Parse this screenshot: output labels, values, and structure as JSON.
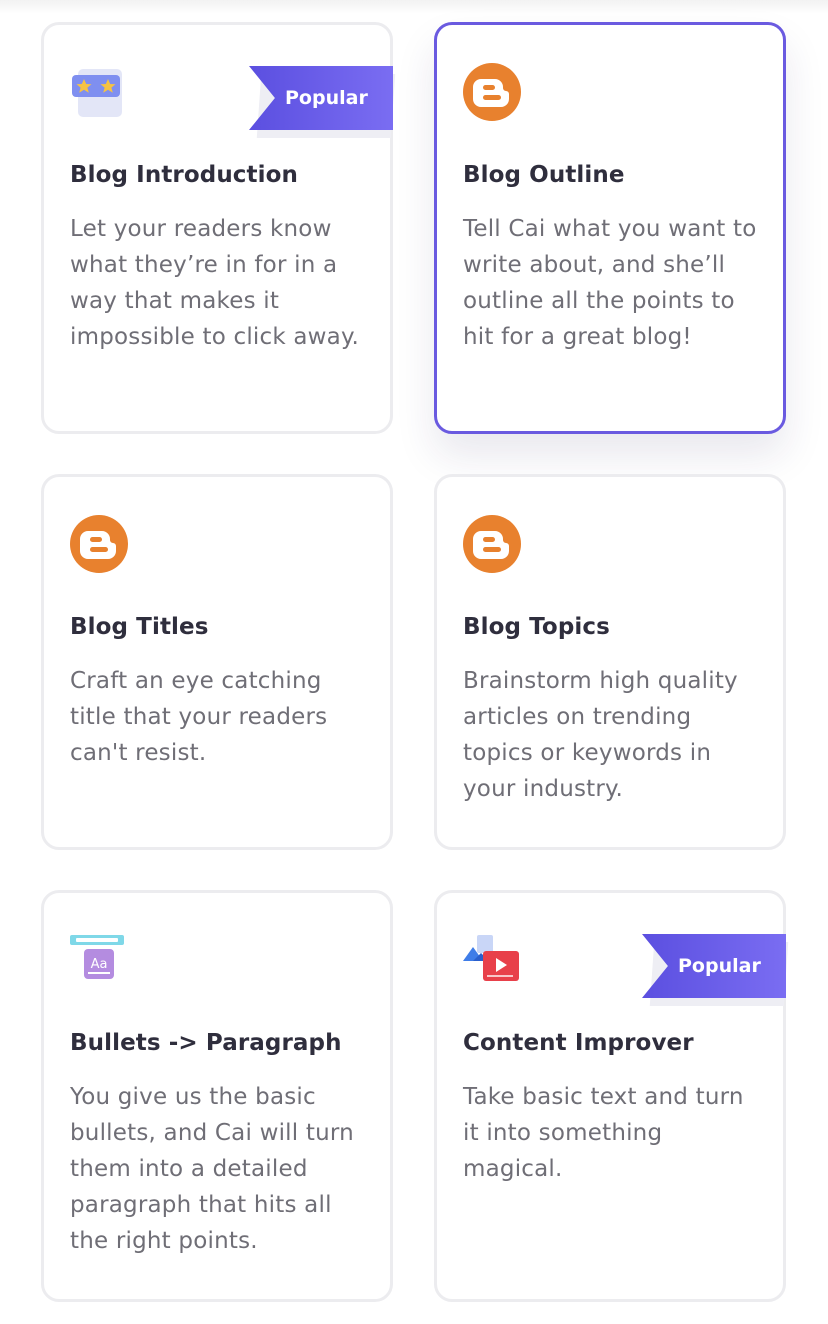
{
  "cards": [
    {
      "title": "Blog Introduction",
      "description": "Let your readers know what they’re in for in a way that makes it impossible to click away.",
      "icon": "rating-stars-icon",
      "badge": "Popular",
      "selected": false
    },
    {
      "title": "Blog Outline",
      "description": "Tell Cai what you want to write about, and she’ll outline all the points to hit for a great blog!",
      "icon": "blogger-icon",
      "badge": "",
      "selected": true
    },
    {
      "title": "Blog Titles",
      "description": "Craft an eye catching title that your readers can't resist.",
      "icon": "blogger-icon",
      "badge": "",
      "selected": false
    },
    {
      "title": "Blog Topics",
      "description": "Brainstorm high quality articles on trending topics or keywords in your industry.",
      "icon": "blogger-icon",
      "badge": "",
      "selected": false
    },
    {
      "title": "Bullets -> Paragraph",
      "description": "You give us the basic bullets, and Cai will turn them into a detailed paragraph that hits all the right points.",
      "icon": "text-format-icon",
      "badge": "",
      "selected": false
    },
    {
      "title": "Content Improver",
      "description": "Take basic text and turn it into something magical.",
      "icon": "media-image-video-icon",
      "badge": "Popular",
      "selected": false
    }
  ],
  "colors": {
    "accent": "#6a5ae0",
    "blogger_orange": "#e8812e",
    "badge_gradient_start": "#5b4fe0",
    "badge_gradient_end": "#7a6df2"
  }
}
